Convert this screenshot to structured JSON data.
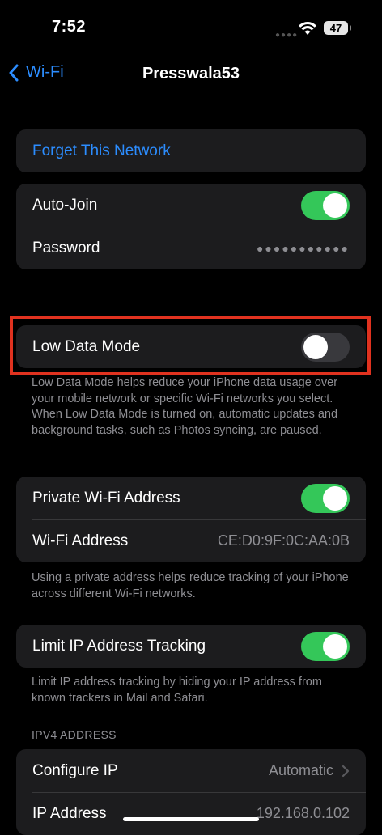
{
  "status": {
    "time": "7:52",
    "battery": "47"
  },
  "nav": {
    "back_label": "Wi-Fi",
    "title": "Presswala53"
  },
  "forget": {
    "label": "Forget This Network"
  },
  "join": {
    "auto_join_label": "Auto-Join",
    "auto_join_on": true,
    "password_label": "Password",
    "password_value": "●●●●●●●●●●●"
  },
  "low_data": {
    "label": "Low Data Mode",
    "on": false,
    "note": "Low Data Mode helps reduce your iPhone data usage over your mobile network or specific Wi-Fi networks you select. When Low Data Mode is turned on, automatic updates and background tasks, such as Photos syncing, are paused."
  },
  "private": {
    "private_label": "Private Wi-Fi Address",
    "private_on": true,
    "address_label": "Wi-Fi Address",
    "address_value": "CE:D0:9F:0C:AA:0B",
    "note": "Using a private address helps reduce tracking of your iPhone across different Wi-Fi networks."
  },
  "limit_ip": {
    "label": "Limit IP Address Tracking",
    "on": true,
    "note": "Limit IP address tracking by hiding your IP address from known trackers in Mail and Safari."
  },
  "ipv4": {
    "header": "IPV4 ADDRESS",
    "configure_label": "Configure IP",
    "configure_value": "Automatic",
    "ip_label": "IP Address",
    "ip_value": "192.168.0.102"
  },
  "colors": {
    "accent": "#2c8dff",
    "toggle_on": "#34c759",
    "highlight": "#e0321f"
  }
}
